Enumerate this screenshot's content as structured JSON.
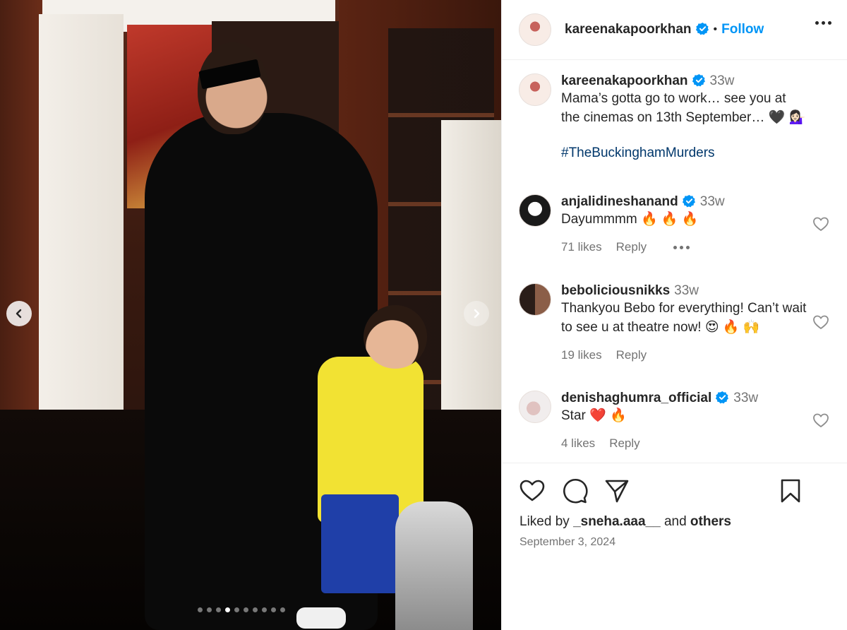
{
  "post": {
    "username": "kareenakapoorkhan",
    "follow_label": "Follow",
    "separator": "•",
    "carousel": {
      "dot_count": 10,
      "active_index": 3
    }
  },
  "caption": {
    "username": "kareenakapoorkhan",
    "time": "33w",
    "text": "Mama’s gotta go to work… see you at the cinemas on 13th September… 🖤 💁🏻‍♀️",
    "hashtag": "#TheBuckinghamMurders"
  },
  "comments": [
    {
      "username": "anjalidineshanand",
      "verified": true,
      "time": "33w",
      "text": "Dayummmm 🔥 🔥 🔥",
      "likes": "71 likes",
      "reply": "Reply"
    },
    {
      "username": "beboliciousnikks",
      "verified": false,
      "time": "33w",
      "text": "Thankyou Bebo for everything! Can’t wait to see u at theatre now! 😍 🔥 🙌",
      "likes": "19 likes",
      "reply": "Reply"
    },
    {
      "username": "denishaghumra_official",
      "verified": true,
      "time": "33w",
      "text": "Star ❤️ 🔥",
      "likes": "4 likes",
      "reply": "Reply"
    }
  ],
  "liked_by": {
    "prefix": "Liked by",
    "user": "_sneha.aaa__",
    "joiner": "and",
    "others": "others"
  },
  "date": "September 3, 2024",
  "colors": {
    "link_blue": "#0095f6",
    "verified_blue": "#0095f6",
    "muted": "#737373",
    "hashtag": "#00376b"
  },
  "icons": [
    "chevron-left-icon",
    "chevron-right-icon",
    "verified-badge-icon",
    "more-icon",
    "heart-icon",
    "comment-icon",
    "share-icon",
    "bookmark-icon"
  ]
}
